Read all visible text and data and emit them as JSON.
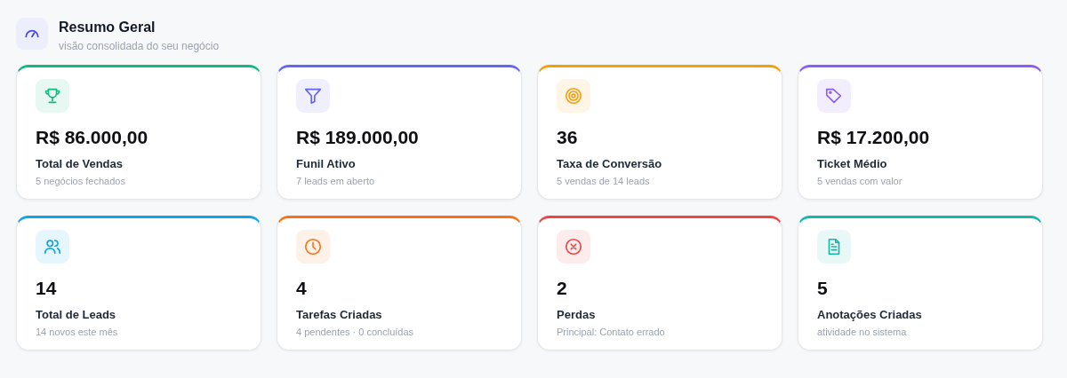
{
  "header": {
    "title": "Resumo Geral",
    "subtitle": "visão consolidada do seu negócio"
  },
  "cards": [
    {
      "value": "R$ 86.000,00",
      "label": "Total de Vendas",
      "detail": "5 negócios fechados",
      "color": "#10b981"
    },
    {
      "value": "R$ 189.000,00",
      "label": "Funil Ativo",
      "detail": "7 leads em aberto",
      "color": "#6366f1"
    },
    {
      "value": "36",
      "label": "Taxa de Conversão",
      "detail": "5 vendas de 14 leads",
      "color": "#f59e0b"
    },
    {
      "value": "R$ 17.200,00",
      "label": "Ticket Médio",
      "detail": "5 vendas com valor",
      "color": "#8b5cf6"
    },
    {
      "value": "14",
      "label": "Total de Leads",
      "detail": "14 novos este mês",
      "color": "#0ea5e9"
    },
    {
      "value": "4",
      "label": "Tarefas Criadas",
      "detail": "4 pendentes · 0 concluídas",
      "color": "#f97316"
    },
    {
      "value": "2",
      "label": "Perdas",
      "detail": "Principal: Contato errado",
      "color": "#ef4444"
    },
    {
      "value": "5",
      "label": "Anotações Criadas",
      "detail": "atividade no sistema",
      "color": "#14b8a6"
    }
  ]
}
